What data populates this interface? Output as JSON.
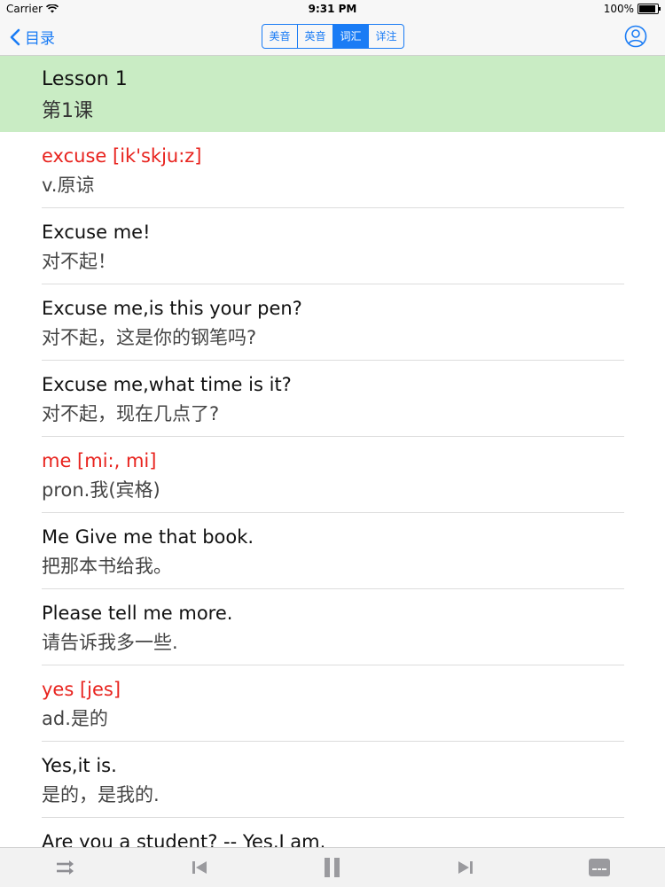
{
  "status_bar": {
    "carrier": "Carrier",
    "time": "9:31 PM",
    "battery": "100%",
    "battery_level": 1.0
  },
  "nav": {
    "back_label": "目录",
    "segments": [
      {
        "label": "美音",
        "active": false
      },
      {
        "label": "英音",
        "active": false
      },
      {
        "label": "词汇",
        "active": true
      },
      {
        "label": "详注",
        "active": false
      }
    ],
    "accent_color": "#1a7cf5"
  },
  "lesson": {
    "title": "Lesson 1",
    "subtitle": "第1课",
    "background": "#c9ecc4"
  },
  "entries": [
    {
      "en": "excuse [ik'skju:z]",
      "zh": "v.原谅",
      "is_word": true
    },
    {
      "en": "Excuse me!",
      "zh": "对不起！",
      "is_word": false
    },
    {
      "en": "Excuse me,is this your pen?",
      "zh": "对不起，这是你的钢笔吗?",
      "is_word": false
    },
    {
      "en": "Excuse me,what time is it?",
      "zh": "对不起，现在几点了?",
      "is_word": false
    },
    {
      "en": "me [mi:, mi]",
      "zh": "pron.我(宾格)",
      "is_word": true
    },
    {
      "en": "Me Give me that book.",
      "zh": "把那本书给我。",
      "is_word": false
    },
    {
      "en": "Please tell me more.",
      "zh": "请告诉我多一些.",
      "is_word": false
    },
    {
      "en": "yes [jes]",
      "zh": "ad.是的",
      "is_word": true
    },
    {
      "en": "Yes,it is.",
      "zh": "是的，是我的.",
      "is_word": false
    },
    {
      "en": "Are you a student? -- Yes,I am.",
      "zh": "",
      "is_word": false
    }
  ],
  "toolbar": {
    "icons": [
      "shuffle-icon",
      "previous-track-icon",
      "pause-icon",
      "next-track-icon",
      "subtitles-icon"
    ]
  },
  "word_color": "#e8231e"
}
